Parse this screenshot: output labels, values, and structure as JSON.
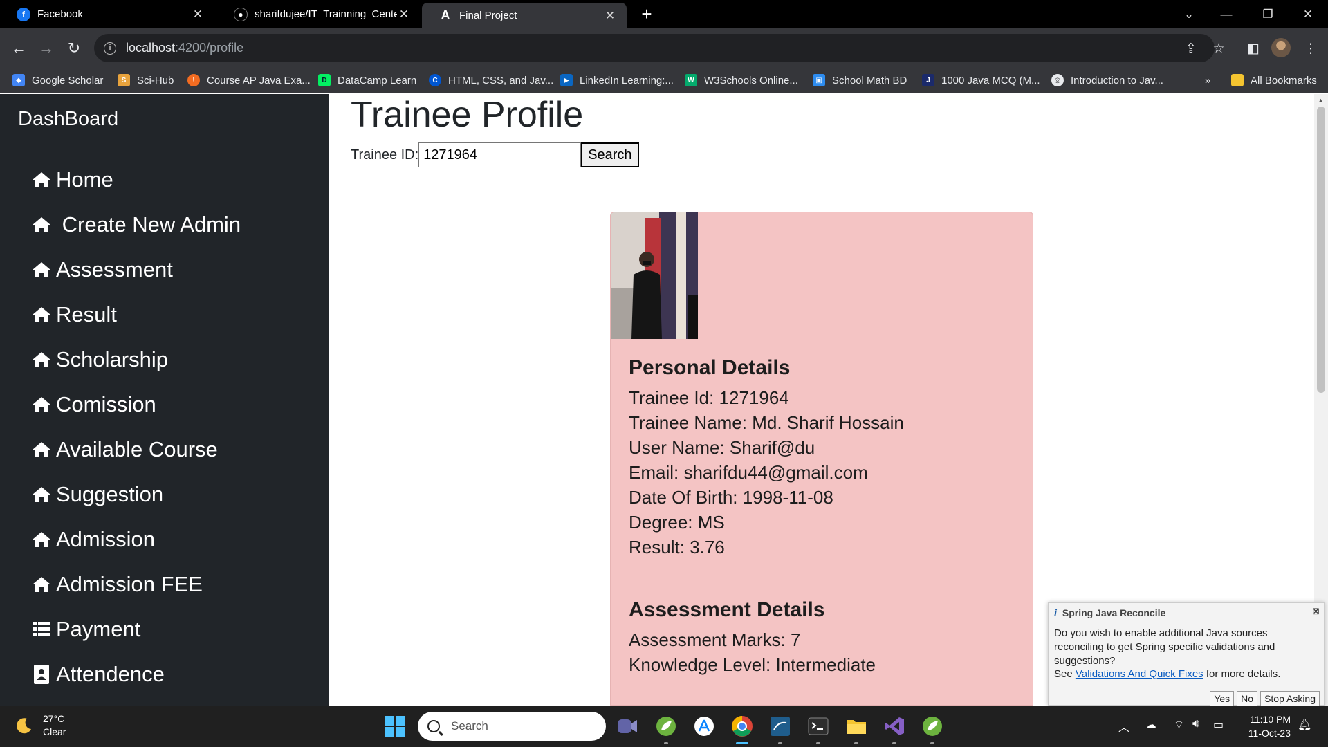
{
  "browser": {
    "tabs": [
      {
        "label": "Facebook",
        "icon": "facebook-icon",
        "active": false
      },
      {
        "label": "sharifdujee/IT_Trainning_Center",
        "icon": "github-icon",
        "active": false
      },
      {
        "label": "Final Project",
        "icon": "angular-icon",
        "active": true
      }
    ],
    "address": {
      "host": "localhost",
      "path": ":4200/profile"
    },
    "bookmarks": [
      {
        "label": "Google Scholar",
        "icon": "google-scholar-icon",
        "color": "#4285f4"
      },
      {
        "label": "Sci-Hub",
        "icon": "scihub-icon",
        "color": "#e8a33d"
      },
      {
        "label": "Course AP Java Exa...",
        "icon": "course-icon",
        "color": "#f36c21"
      },
      {
        "label": "DataCamp Learn",
        "icon": "datacamp-icon",
        "color": "#03ef62"
      },
      {
        "label": "HTML, CSS, and Jav...",
        "icon": "coursera-icon",
        "color": "#0056d2"
      },
      {
        "label": "LinkedIn Learning:...",
        "icon": "linkedin-learning-icon",
        "color": "#0a66c2"
      },
      {
        "label": "W3Schools Online...",
        "icon": "w3schools-icon",
        "color": "#04aa6d"
      },
      {
        "label": "School Math BD",
        "icon": "schoolmath-icon",
        "color": "#2d8cf0"
      },
      {
        "label": "1000 Java MCQ (M...",
        "icon": "javamcq-icon",
        "color": "#1b2a6b"
      },
      {
        "label": "Introduction to Jav...",
        "icon": "globe-icon",
        "color": "#e8eaed"
      }
    ],
    "more_bookmarks": "»",
    "all_bookmarks": "All Bookmarks"
  },
  "sidebar": {
    "brand": "DashBoard",
    "items": [
      {
        "label": "Home",
        "icon": "home-icon"
      },
      {
        "label": " Create New Admin",
        "icon": "home-icon"
      },
      {
        "label": "Assessment",
        "icon": "home-icon"
      },
      {
        "label": "Result",
        "icon": "home-icon"
      },
      {
        "label": "Scholarship",
        "icon": "home-icon"
      },
      {
        "label": "Comission",
        "icon": "home-icon"
      },
      {
        "label": "Available Course",
        "icon": "home-icon"
      },
      {
        "label": "Suggestion",
        "icon": "home-icon"
      },
      {
        "label": "Admission",
        "icon": "home-icon"
      },
      {
        "label": "Admission FEE",
        "icon": "home-icon"
      },
      {
        "label": "Payment",
        "icon": "list-icon"
      },
      {
        "label": "Attendence",
        "icon": "id-card-icon"
      }
    ]
  },
  "main": {
    "title": "Trainee Profile",
    "search": {
      "label": "Trainee ID:",
      "value": "1271964",
      "button": "Search"
    },
    "personal": {
      "heading": "Personal Details",
      "rows": [
        "Trainee Id: 1271964",
        "Trainee Name: Md. Sharif Hossain",
        "User Name: Sharif@du",
        "Email: sharifdu44@gmail.com",
        "Date Of Birth: 1998-11-08",
        "Degree: MS",
        "Result: 3.76"
      ]
    },
    "assessment": {
      "heading": "Assessment Details",
      "rows": [
        "Assessment Marks: 7",
        "Knowledge Level: Intermediate"
      ]
    }
  },
  "notification": {
    "title": "Spring Java Reconcile",
    "message": "Do you wish to enable additional Java sources reconciling to get Spring specific validations and suggestions?",
    "see": "See",
    "link": "Validations And Quick Fixes",
    "more": "for more details.",
    "buttons": [
      "Yes",
      "No",
      "Stop Asking"
    ]
  },
  "taskbar": {
    "weather": {
      "temp": "27°C",
      "condition": "Clear"
    },
    "search_placeholder": "Search",
    "time": "11:10 PM",
    "date": "11-Oct-23"
  }
}
